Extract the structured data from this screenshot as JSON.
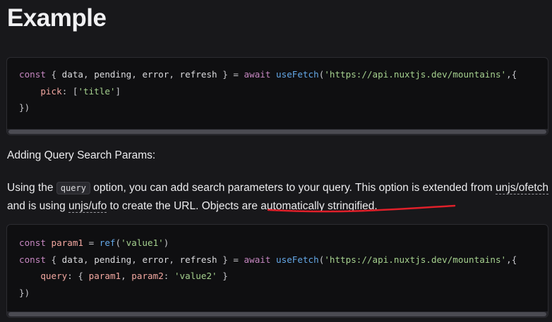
{
  "page": {
    "heading": "Example"
  },
  "code1": {
    "lines": [
      [
        [
          "kw",
          "const "
        ],
        [
          "punc",
          "{ "
        ],
        [
          "plain",
          "data"
        ],
        [
          "punc",
          ", "
        ],
        [
          "plain",
          "pending"
        ],
        [
          "punc",
          ", "
        ],
        [
          "plain",
          "error"
        ],
        [
          "punc",
          ", "
        ],
        [
          "plain",
          "refresh "
        ],
        [
          "punc",
          "} = "
        ],
        [
          "kw",
          "await "
        ],
        [
          "fn",
          "useFetch"
        ],
        [
          "punc",
          "("
        ],
        [
          "str",
          "'https://api.nuxtjs.dev/mountains'"
        ],
        [
          "punc",
          ",{"
        ]
      ],
      [
        [
          "plain",
          "    "
        ],
        [
          "prop",
          "pick"
        ],
        [
          "punc",
          ": ["
        ],
        [
          "str",
          "'title'"
        ],
        [
          "punc",
          "]"
        ]
      ],
      [
        [
          "punc",
          "})"
        ]
      ]
    ]
  },
  "section": {
    "subtitle": "Adding Query Search Params:",
    "para_before_code": "Using the ",
    "inline_code": "query",
    "para_mid1": " option, you can add search parameters to your query. This option is extended from ",
    "link1": "unjs/ofetch",
    "para_mid2": " and is using ",
    "link2": "unjs/ufo",
    "para_mid3": " to create the URL. Objects are automatically stringified."
  },
  "code2": {
    "lines": [
      [
        [
          "kw",
          "const "
        ],
        [
          "var",
          "param1"
        ],
        [
          "punc",
          " = "
        ],
        [
          "fn",
          "ref"
        ],
        [
          "punc",
          "("
        ],
        [
          "str",
          "'value1'"
        ],
        [
          "punc",
          ")"
        ]
      ],
      [
        [
          "kw",
          "const "
        ],
        [
          "punc",
          "{ "
        ],
        [
          "plain",
          "data"
        ],
        [
          "punc",
          ", "
        ],
        [
          "plain",
          "pending"
        ],
        [
          "punc",
          ", "
        ],
        [
          "plain",
          "error"
        ],
        [
          "punc",
          ", "
        ],
        [
          "plain",
          "refresh "
        ],
        [
          "punc",
          "} = "
        ],
        [
          "kw",
          "await "
        ],
        [
          "fn",
          "useFetch"
        ],
        [
          "punc",
          "("
        ],
        [
          "str",
          "'https://api.nuxtjs.dev/mountains'"
        ],
        [
          "punc",
          ",{"
        ]
      ],
      [
        [
          "plain",
          "    "
        ],
        [
          "prop",
          "query"
        ],
        [
          "punc",
          ": { "
        ],
        [
          "var",
          "param1"
        ],
        [
          "punc",
          ", "
        ],
        [
          "prop",
          "param2"
        ],
        [
          "punc",
          ": "
        ],
        [
          "str",
          "'value2'"
        ],
        [
          "punc",
          " }"
        ]
      ],
      [
        [
          "punc",
          "})"
        ]
      ]
    ]
  },
  "colors": {
    "annotation": "#e0202a",
    "keyword": "#c586c0",
    "function": "#64a8e8",
    "string": "#a5d08e",
    "property": "#f2a7a0"
  }
}
